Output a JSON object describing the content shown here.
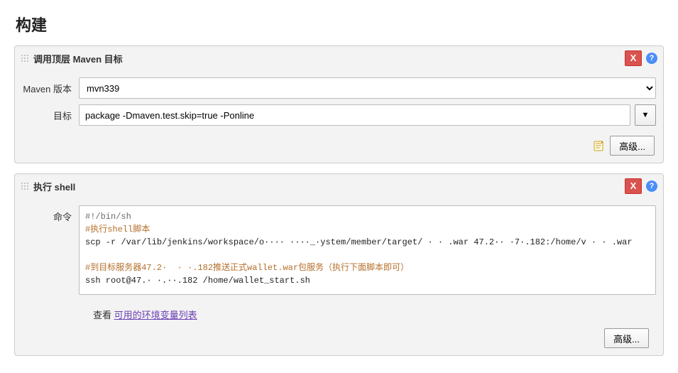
{
  "section": {
    "title": "构建"
  },
  "maven": {
    "block_title": "调用顶层 Maven 目标",
    "close_label": "X",
    "version_label": "Maven 版本",
    "version_value": "mvn339",
    "goal_label": "目标",
    "goal_value": "package -Dmaven.test.skip=true -Ponline",
    "advanced_label": "高级..."
  },
  "shell": {
    "block_title": "执行 shell",
    "close_label": "X",
    "cmd_label": "命令",
    "script_lines": [
      {
        "text": "#!/bin/sh",
        "cls": "c-gray"
      },
      {
        "text": "#执行shell脚本",
        "cls": "c-orange"
      },
      {
        "text": "scp -r /var/lib/jenkins/workspace/o···· ····_·ystem/member/target/ · · .war 47.2·· ·7·.182:/home/v · · .war",
        "cls": "c-black"
      },
      {
        "text": "",
        "cls": "c-black"
      },
      {
        "text": "#到目标服务器47.2·  · ·.182推送正式wallet.war包服务（执行下面脚本即可）",
        "cls": "c-orange"
      },
      {
        "text": "ssh root@47.· ·.··.182 /home/wallet_start.sh",
        "cls": "c-black"
      }
    ],
    "hint_prefix": "查看 ",
    "hint_link": "可用的环境变量列表",
    "advanced_label": "高级..."
  }
}
